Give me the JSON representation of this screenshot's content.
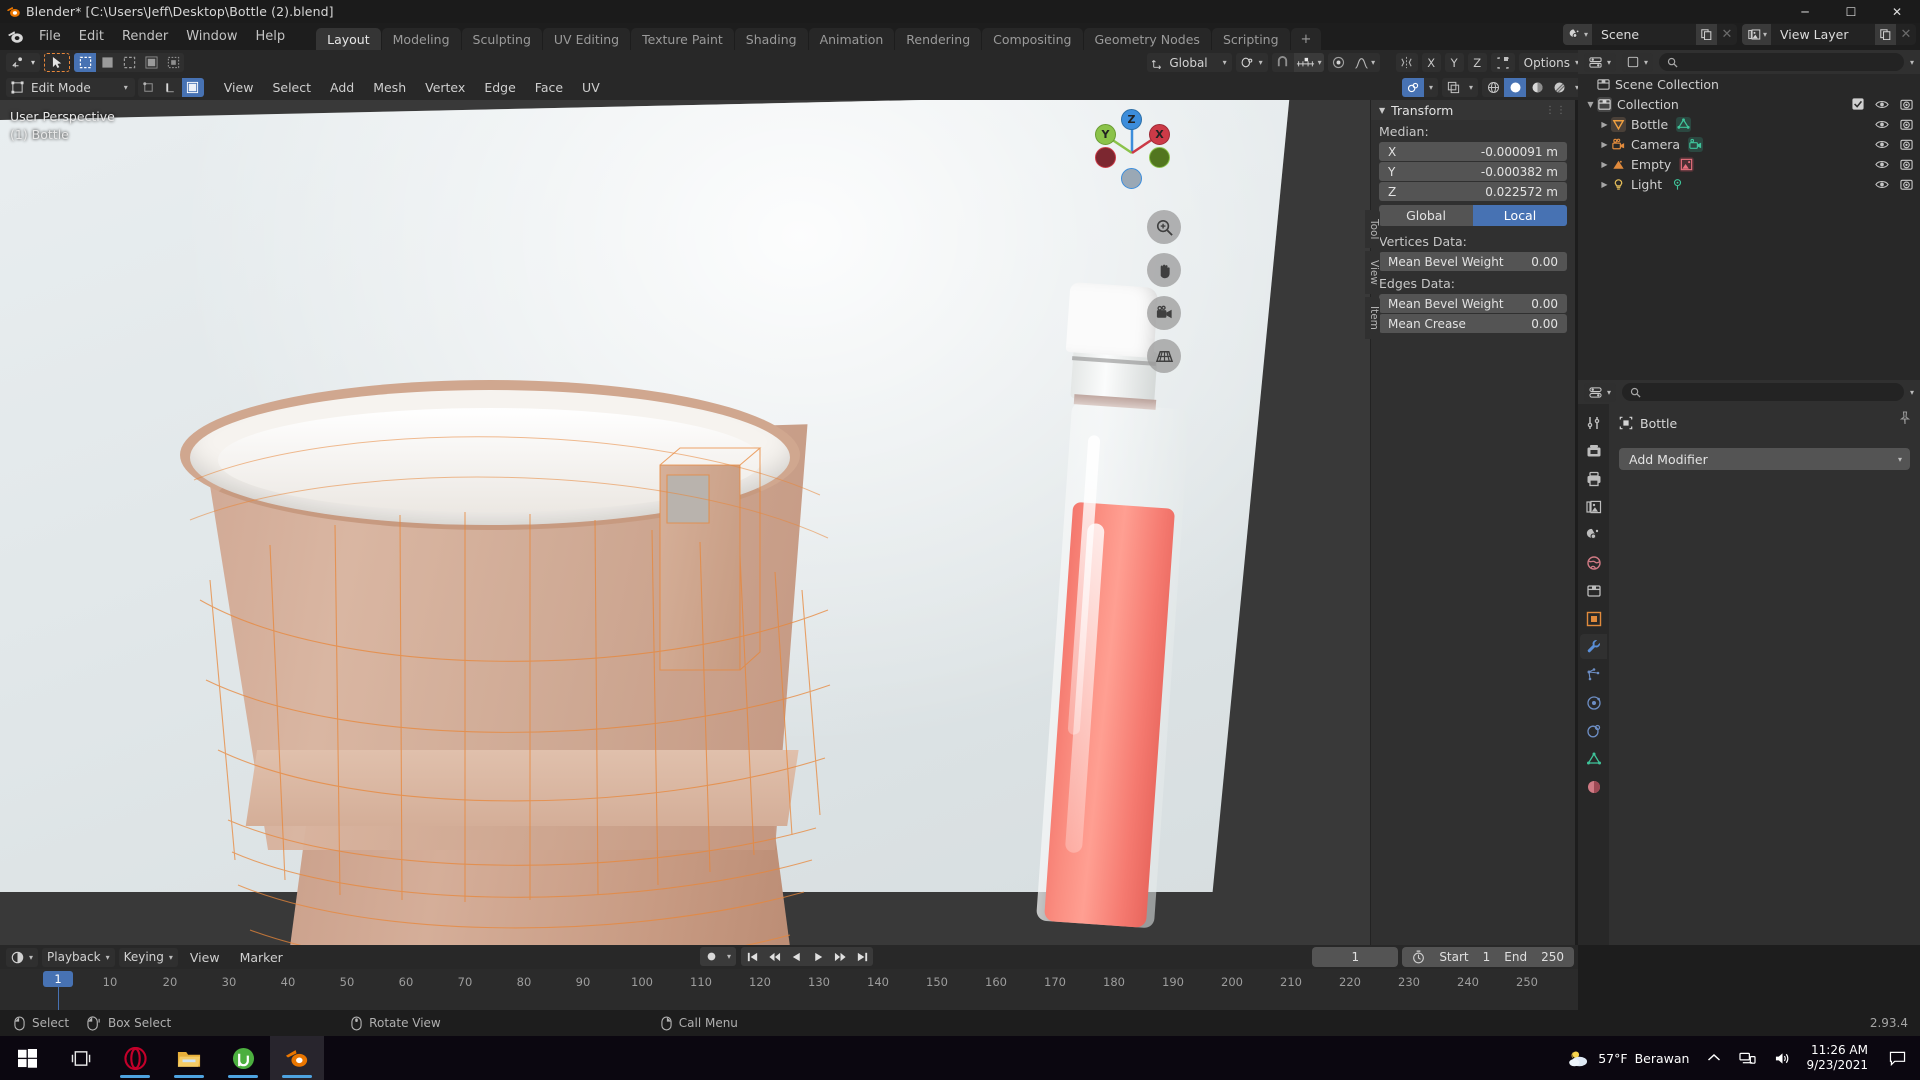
{
  "window": {
    "title": "Blender* [C:\\Users\\Jeff\\Desktop\\Bottle (2).blend]",
    "minimize": "─",
    "maximize": "☐",
    "close": "✕"
  },
  "topbar": {
    "menus": [
      "File",
      "Edit",
      "Render",
      "Window",
      "Help"
    ],
    "workspaces": [
      "Layout",
      "Modeling",
      "Sculpting",
      "UV Editing",
      "Texture Paint",
      "Shading",
      "Animation",
      "Rendering",
      "Compositing",
      "Geometry Nodes",
      "Scripting"
    ],
    "active_workspace": "Layout",
    "add_workspace": "+",
    "scene_name": "Scene",
    "view_layer_name": "View Layer"
  },
  "viewport_header": {
    "mode": "Edit Mode",
    "menus": [
      "View",
      "Select",
      "Add",
      "Mesh",
      "Vertex",
      "Edge",
      "Face",
      "UV"
    ],
    "transform_orientation": "Global",
    "options_label": "Options",
    "axis_buttons": [
      "X",
      "Y",
      "Z"
    ]
  },
  "viewport": {
    "perspective_label": "User Perspective",
    "object_label": "(1) Bottle",
    "gizmo_axes": [
      "X",
      "Y",
      "Z"
    ],
    "sidebar_tabs": [
      "Tool",
      "View",
      "Item"
    ]
  },
  "npanel": {
    "title": "Transform",
    "median_label": "Median:",
    "fields": [
      {
        "label": "X",
        "value": "-0.000091 m"
      },
      {
        "label": "Y",
        "value": "-0.000382 m"
      },
      {
        "label": "Z",
        "value": "0.022572 m"
      }
    ],
    "space_global": "Global",
    "space_local": "Local",
    "space_active": "Local",
    "vertices_data_label": "Vertices Data:",
    "vertices_rows": [
      {
        "label": "Mean Bevel Weight",
        "value": "0.00"
      }
    ],
    "edges_data_label": "Edges Data:",
    "edges_rows": [
      {
        "label": "Mean Bevel Weight",
        "value": "0.00"
      },
      {
        "label": "Mean Crease",
        "value": "0.00"
      }
    ]
  },
  "outliner": {
    "scene_collection": "Scene Collection",
    "collection": "Collection",
    "items": [
      {
        "name": "Bottle",
        "type": "mesh"
      },
      {
        "name": "Camera",
        "type": "camera"
      },
      {
        "name": "Empty",
        "type": "image"
      },
      {
        "name": "Light",
        "type": "light"
      }
    ]
  },
  "properties": {
    "breadcrumb_object": "Bottle",
    "add_modifier": "Add Modifier",
    "active_tab": "modifier"
  },
  "timeline": {
    "menus": [
      "Playback",
      "Keying",
      "View",
      "Marker"
    ],
    "current_frame": "1",
    "start_label": "Start",
    "start_value": "1",
    "end_label": "End",
    "end_value": "250",
    "ticks": [
      "10",
      "20",
      "30",
      "40",
      "50",
      "60",
      "70",
      "80",
      "90",
      "100",
      "110",
      "120",
      "130",
      "140",
      "150",
      "160",
      "170",
      "180",
      "190",
      "200",
      "210",
      "220",
      "230",
      "240",
      "250"
    ],
    "playhead_frame": "1"
  },
  "statusbar": {
    "hints": [
      {
        "label": "Select",
        "icon": "mouse-left-icon"
      },
      {
        "label": "Box Select",
        "icon": "mouse-drag-icon"
      },
      {
        "label": "Rotate View",
        "icon": "mouse-middle-icon"
      },
      {
        "label": "Call Menu",
        "icon": "mouse-right-icon"
      }
    ],
    "version": "2.93.4"
  },
  "taskbar": {
    "apps": [
      "start-icon",
      "task-view-icon",
      "opera-icon",
      "file-explorer-icon",
      "utorrent-icon",
      "blender-icon"
    ],
    "weather_temp": "57°F",
    "weather_desc": "Berawan",
    "time": "11:26 AM",
    "date": "9/23/2021"
  },
  "colors": {
    "accent_blue": "#4772b3",
    "header_bg": "#282828",
    "panel_bg": "#303030",
    "field_bg": "#545454",
    "axis_x": "#cc3a47",
    "axis_y": "#8bc34a",
    "axis_z": "#3c8ddb",
    "mesh_orange": "#e8873a",
    "liquid_pink": "#f57a70"
  }
}
